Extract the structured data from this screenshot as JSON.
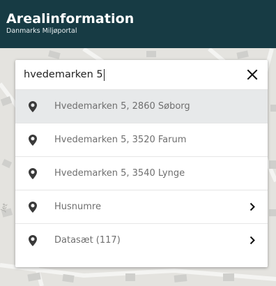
{
  "header": {
    "title": "Arealinformation",
    "subtitle": "Danmarks Miljøportal"
  },
  "search": {
    "value": "hvedemarken 5",
    "clear_icon": "close-icon"
  },
  "results": [
    {
      "label": "Hvedemarken 5, 2860 Søborg",
      "icon": "map-pin-icon",
      "active": true,
      "has_chevron": false
    },
    {
      "label": "Hvedemarken 5, 3520 Farum",
      "icon": "map-pin-icon",
      "active": false,
      "has_chevron": false
    },
    {
      "label": "Hvedemarken 5, 3540 Lynge",
      "icon": "map-pin-icon",
      "active": false,
      "has_chevron": false
    },
    {
      "label": "Husnumre",
      "icon": "map-pin-icon",
      "active": false,
      "has_chevron": true
    },
    {
      "label": "Datasæt (117)",
      "icon": "map-pin-icon",
      "active": false,
      "has_chevron": true
    }
  ],
  "colors": {
    "header_bg": "#173b44",
    "active_row_bg": "#e7e9ea",
    "map_bg": "#e4e3df"
  }
}
